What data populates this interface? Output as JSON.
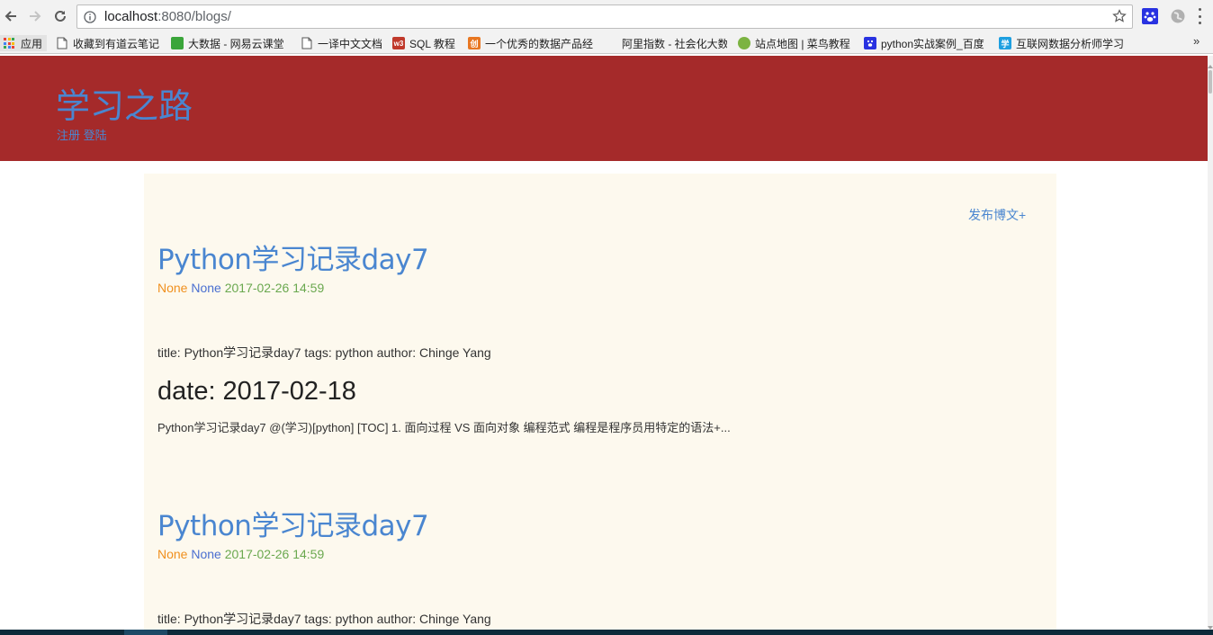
{
  "browser": {
    "url_host": "localhost",
    "url_path": ":8080/blogs/"
  },
  "bookmarks": [
    {
      "label": "应用",
      "icon": "apps-grid-icon"
    },
    {
      "label": "收藏到有道云笔记",
      "icon": "page-icon"
    },
    {
      "label": "大数据 - 网易云课堂",
      "icon": "netease-study-icon"
    },
    {
      "label": "一译中文文档",
      "icon": "page-icon"
    },
    {
      "label": "SQL 教程",
      "icon": "w3school-icon"
    },
    {
      "label": "一个优秀的数据产品经",
      "icon": "zhihu-like-icon"
    },
    {
      "label": "阿里指数 - 社会化大数",
      "icon": "blank-icon"
    },
    {
      "label": "站点地图 | 菜鸟教程",
      "icon": "runoob-icon"
    },
    {
      "label": "python实战案例_百度",
      "icon": "baidu-paw-icon"
    },
    {
      "label": "互联网数据分析师学习",
      "icon": "xue-icon"
    }
  ],
  "site": {
    "title": "学习之路",
    "register": "注册",
    "login": "登陆",
    "publish": "发布博文+"
  },
  "posts": [
    {
      "title": "Python学习记录day7",
      "category": "None",
      "tag": "None",
      "date": "2017-02-26 14:59",
      "front_matter": "title: Python学习记录day7 tags: python author: Chinge Yang",
      "heading": "date: 2017-02-18",
      "summary": "Python学习记录day7 @(学习)[python] [TOC] 1. 面向过程 VS 面向对象 编程范式 编程是程序员用特定的语法+..."
    },
    {
      "title": "Python学习记录day7",
      "category": "None",
      "tag": "None",
      "date": "2017-02-26 14:59",
      "front_matter": "title: Python学习记录day7 tags: python author: Chinge Yang"
    }
  ],
  "colors": {
    "header_bg": "#a52a2a",
    "link": "#4a86d0",
    "content_bg": "#fdf9ee",
    "category": "#f0901e",
    "tag": "#4a6fd0",
    "date": "#6aa84f"
  }
}
